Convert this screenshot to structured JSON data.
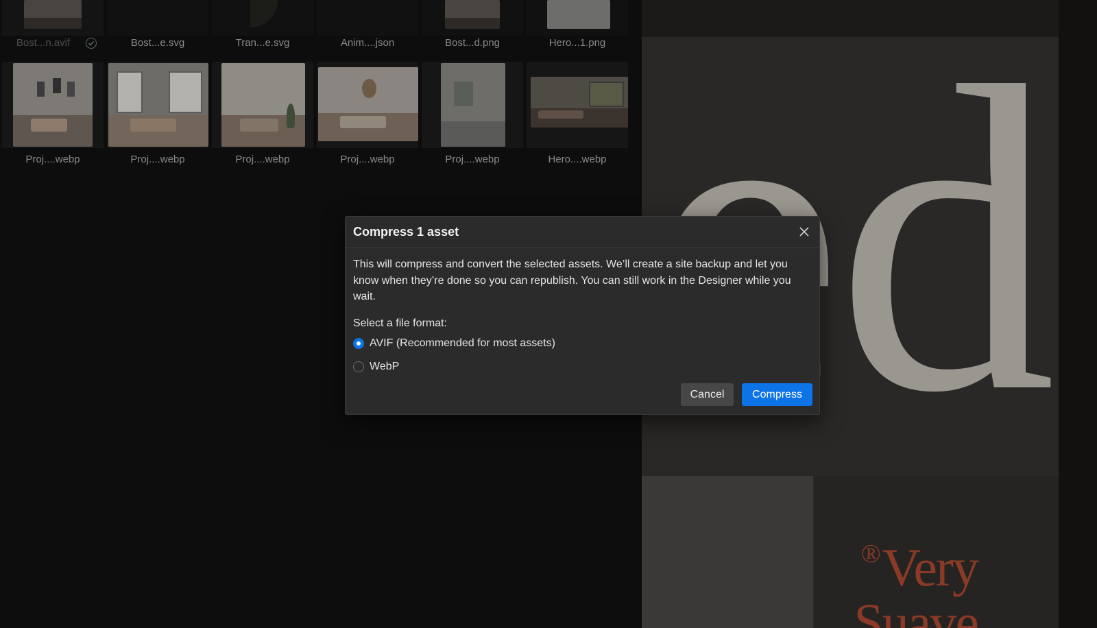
{
  "asset_panel": {
    "row1": [
      {
        "label": "Bost...n.avif",
        "checked": true
      },
      {
        "label": "Bost...e.svg"
      },
      {
        "label": "Tran...e.svg"
      },
      {
        "label": "Anim....json"
      },
      {
        "label": "Bost...d.png"
      },
      {
        "label": "Hero...1.png"
      }
    ],
    "row2": [
      {
        "label": "Proj....webp"
      },
      {
        "label": "Proj....webp"
      },
      {
        "label": "Proj....webp"
      },
      {
        "label": "Proj....webp"
      },
      {
        "label": "Proj....webp"
      },
      {
        "label": "Hero....webp"
      }
    ]
  },
  "canvas": {
    "big_letters": "ed",
    "brand_reg": "®",
    "brand_line1": "Very",
    "brand_line2": "Suave"
  },
  "dialog": {
    "title": "Compress 1 asset",
    "body": "This will compress and convert the selected assets. We’ll create a site backup and let you know when they’re done so you can republish. You can still work in the Designer while you wait.",
    "format_label": "Select a file format:",
    "options": [
      {
        "label": "AVIF (Recommended for most assets)",
        "selected": true
      },
      {
        "label": "WebP",
        "selected": false
      }
    ],
    "cancel_label": "Cancel",
    "compress_label": "Compress"
  },
  "colors": {
    "accent": "#0d74e8",
    "dialog_bg": "#2b2b2b",
    "brand_red": "#8a3a26"
  }
}
